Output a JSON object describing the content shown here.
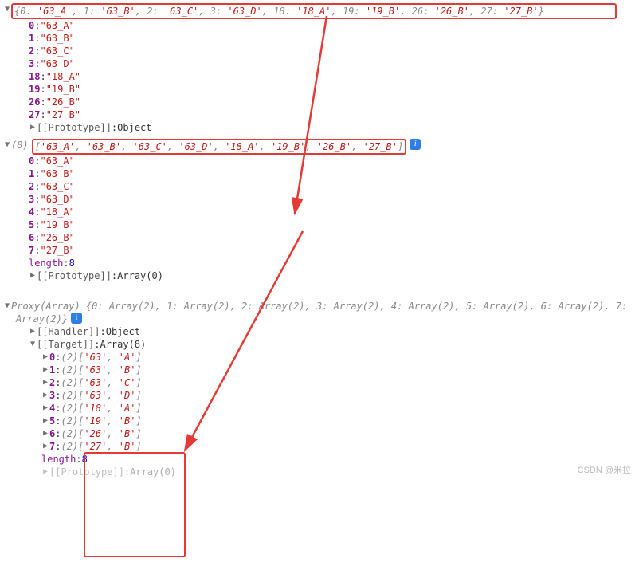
{
  "watermark": "CSDN @米拉",
  "block1": {
    "summary_prefix": "{",
    "summary_pairs": [
      {
        "k": "0",
        "v": "'63_A'"
      },
      {
        "k": "1",
        "v": "'63_B'"
      },
      {
        "k": "2",
        "v": "'63_C'"
      },
      {
        "k": "3",
        "v": "'63_D'"
      },
      {
        "k": "18",
        "v": "'18_A'"
      },
      {
        "k": "19",
        "v": "'19_B'"
      },
      {
        "k": "26",
        "v": "'26_B'"
      },
      {
        "k": "27",
        "v": "'27_B'"
      }
    ],
    "summary_suffix": "}",
    "rows": [
      {
        "k": "0",
        "v": "\"63_A\""
      },
      {
        "k": "1",
        "v": "\"63_B\""
      },
      {
        "k": "2",
        "v": "\"63_C\""
      },
      {
        "k": "3",
        "v": "\"63_D\""
      },
      {
        "k": "18",
        "v": "\"18_A\""
      },
      {
        "k": "19",
        "v": "\"19_B\""
      },
      {
        "k": "26",
        "v": "\"26_B\""
      },
      {
        "k": "27",
        "v": "\"27_B\""
      }
    ],
    "proto_label": "[[Prototype]]",
    "proto_value": "Object"
  },
  "block2": {
    "count": "(8)",
    "summary": "['63_A', '63_B', '63_C', '63_D', '18_A', '19_B', '26_B', '27_B']",
    "rows": [
      {
        "k": "0",
        "v": "\"63_A\""
      },
      {
        "k": "1",
        "v": "\"63_B\""
      },
      {
        "k": "2",
        "v": "\"63_C\""
      },
      {
        "k": "3",
        "v": "\"63_D\""
      },
      {
        "k": "4",
        "v": "\"18_A\""
      },
      {
        "k": "5",
        "v": "\"19_B\""
      },
      {
        "k": "6",
        "v": "\"26_B\""
      },
      {
        "k": "7",
        "v": "\"27_B\""
      }
    ],
    "length_label": "length",
    "length_value": "8",
    "proto_label": "[[Prototype]]",
    "proto_value": "Array(0)"
  },
  "block3": {
    "header_prefix": "Proxy(Array) ",
    "header_pairs": [
      {
        "k": "0",
        "v": "Array(2)"
      },
      {
        "k": "1",
        "v": "Array(2)"
      },
      {
        "k": "2",
        "v": "Array(2)"
      },
      {
        "k": "3",
        "v": "Array(2)"
      },
      {
        "k": "4",
        "v": "Array(2)"
      },
      {
        "k": "5",
        "v": "Array(2)"
      },
      {
        "k": "6",
        "v": "Array(2)"
      }
    ],
    "header_suffix": "Array(2)}",
    "handler_label": "[[Handler]]",
    "handler_value": "Object",
    "target_label": "[[Target]]",
    "target_value": "Array(8)",
    "target_rows": [
      {
        "k": "0",
        "count": "(2)",
        "a": "'63'",
        "b": "'A'"
      },
      {
        "k": "1",
        "count": "(2)",
        "a": "'63'",
        "b": "'B'"
      },
      {
        "k": "2",
        "count": "(2)",
        "a": "'63'",
        "b": "'C'"
      },
      {
        "k": "3",
        "count": "(2)",
        "a": "'63'",
        "b": "'D'"
      },
      {
        "k": "4",
        "count": "(2)",
        "a": "'18'",
        "b": "'A'"
      },
      {
        "k": "5",
        "count": "(2)",
        "a": "'19'",
        "b": "'B'"
      },
      {
        "k": "6",
        "count": "(2)",
        "a": "'26'",
        "b": "'B'"
      },
      {
        "k": "7",
        "count": "(2)",
        "a": "'27'",
        "b": "'B'"
      }
    ],
    "length_label": "length",
    "length_value": "8",
    "proto_label": "[[Prototype]]",
    "proto_value": "Array(0)"
  }
}
